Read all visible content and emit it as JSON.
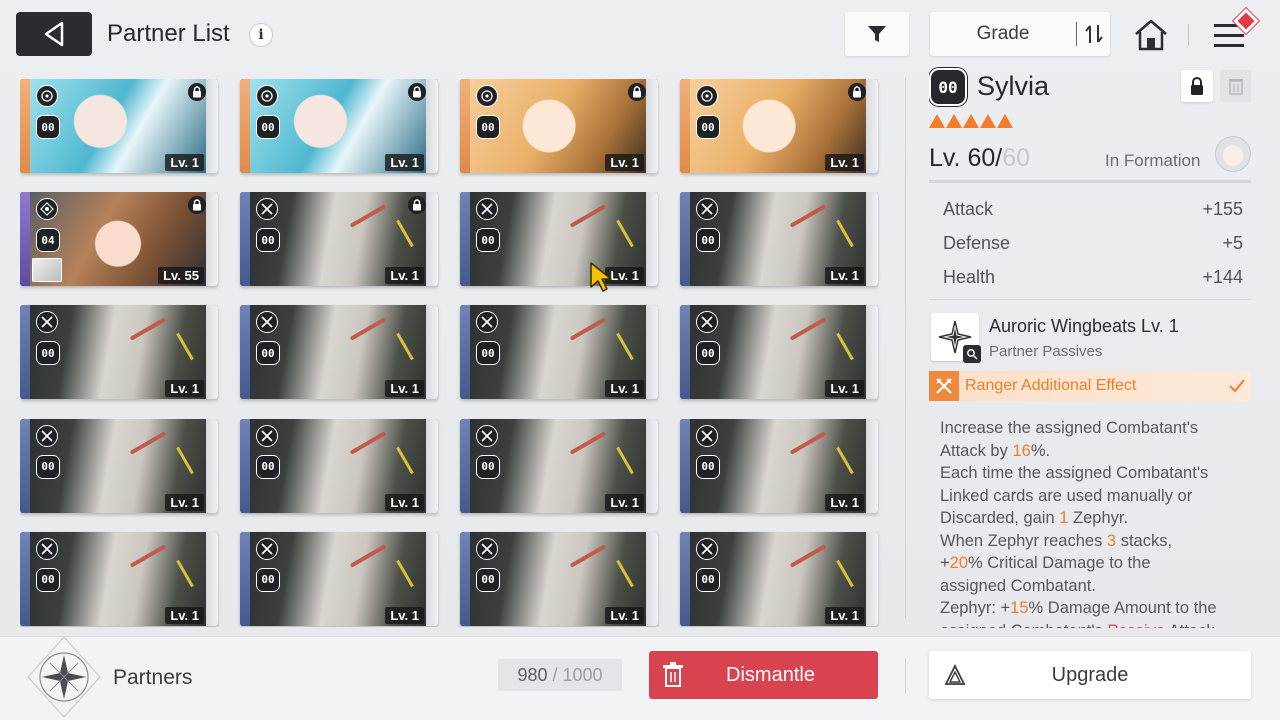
{
  "header": {
    "title": "Partner List",
    "info_glyph": "i",
    "sort_label": "Grade"
  },
  "cards": [
    {
      "art": "teal",
      "type": "compass",
      "code": "00",
      "level": "Lv. 1",
      "locked": true,
      "equip": false
    },
    {
      "art": "teal",
      "type": "compass",
      "code": "00",
      "level": "Lv. 1",
      "locked": true,
      "equip": false
    },
    {
      "art": "blonde",
      "type": "compass",
      "code": "00",
      "level": "Lv. 1",
      "locked": true,
      "equip": false
    },
    {
      "art": "blonde",
      "type": "compass",
      "code": "00",
      "level": "Lv. 1",
      "locked": true,
      "equip": false
    },
    {
      "art": "brown",
      "type": "target",
      "code": "04",
      "level": "Lv. 55",
      "locked": true,
      "equip": true
    },
    {
      "art": "soldier",
      "type": "swords",
      "code": "00",
      "level": "Lv. 1",
      "locked": true,
      "equip": false
    },
    {
      "art": "soldier",
      "type": "swords",
      "code": "00",
      "level": "Lv. 1",
      "locked": false,
      "equip": false
    },
    {
      "art": "soldier",
      "type": "swords",
      "code": "00",
      "level": "Lv. 1",
      "locked": false,
      "equip": false
    },
    {
      "art": "soldier",
      "type": "swords",
      "code": "00",
      "level": "Lv. 1",
      "locked": false,
      "equip": false
    },
    {
      "art": "soldier",
      "type": "swords",
      "code": "00",
      "level": "Lv. 1",
      "locked": false,
      "equip": false
    },
    {
      "art": "soldier",
      "type": "swords",
      "code": "00",
      "level": "Lv. 1",
      "locked": false,
      "equip": false
    },
    {
      "art": "soldier",
      "type": "swords",
      "code": "00",
      "level": "Lv. 1",
      "locked": false,
      "equip": false
    },
    {
      "art": "soldier",
      "type": "swords",
      "code": "00",
      "level": "Lv. 1",
      "locked": false,
      "equip": false
    },
    {
      "art": "soldier",
      "type": "swords",
      "code": "00",
      "level": "Lv. 1",
      "locked": false,
      "equip": false
    },
    {
      "art": "soldier",
      "type": "swords",
      "code": "00",
      "level": "Lv. 1",
      "locked": false,
      "equip": false
    },
    {
      "art": "soldier",
      "type": "swords",
      "code": "00",
      "level": "Lv. 1",
      "locked": false,
      "equip": false
    },
    {
      "art": "soldier",
      "type": "swords",
      "code": "00",
      "level": "Lv. 1",
      "locked": false,
      "equip": false
    },
    {
      "art": "soldier",
      "type": "swords",
      "code": "00",
      "level": "Lv. 1",
      "locked": false,
      "equip": false
    },
    {
      "art": "soldier",
      "type": "swords",
      "code": "00",
      "level": "Lv. 1",
      "locked": false,
      "equip": false
    },
    {
      "art": "soldier",
      "type": "swords",
      "code": "00",
      "level": "Lv. 1",
      "locked": false,
      "equip": false
    }
  ],
  "detail": {
    "code": "00",
    "name": "Sylvia",
    "stars": 5,
    "level_prefix": "Lv. 60/",
    "level_max": "60",
    "formation": "In Formation",
    "stats": [
      {
        "label": "Attack",
        "value": "+155"
      },
      {
        "label": "Defense",
        "value": "+5"
      },
      {
        "label": "Health",
        "value": "+144"
      }
    ],
    "skill_name": "Auroric Wingbeats Lv. 1",
    "skill_type": "Partner Passives",
    "effect_label": "Ranger Additional Effect",
    "description": [
      [
        {
          "t": "Increase the assigned Combatant's "
        }
      ],
      [
        {
          "t": "Attack by "
        },
        {
          "t": "16",
          "c": "hl"
        },
        {
          "t": "%."
        }
      ],
      [
        {
          "t": "Each time the assigned Combatant's"
        }
      ],
      [
        {
          "t": "Linked cards are used manually or"
        }
      ],
      [
        {
          "t": "Discarded, gain "
        },
        {
          "t": "1",
          "c": "hl"
        },
        {
          "t": " Zephyr."
        }
      ],
      [
        {
          "t": "When Zephyr reaches "
        },
        {
          "t": "3",
          "c": "hl"
        },
        {
          "t": " stacks,"
        }
      ],
      [
        {
          "t": "+"
        },
        {
          "t": "20",
          "c": "hl"
        },
        {
          "t": "% Critical Damage to the"
        }
      ],
      [
        {
          "t": "assigned Combatant."
        }
      ],
      [
        {
          "t": "Zephyr: +"
        },
        {
          "t": "15",
          "c": "hl"
        },
        {
          "t": "% Damage Amount to the"
        }
      ],
      [
        {
          "t": "assigned Combatant's "
        },
        {
          "t": "Passive",
          "c": "hl-red"
        },
        {
          "t": " Attack"
        }
      ]
    ]
  },
  "footer": {
    "section_label": "Partners",
    "capacity_current": "980",
    "capacity_sep": "/",
    "capacity_total": "1000",
    "dismantle_label": "Dismantle",
    "upgrade_label": "Upgrade"
  },
  "colors": {
    "accent_orange": "#ef7d2b",
    "dismantle_red": "#d9434f",
    "dark": "#2a2c31"
  }
}
